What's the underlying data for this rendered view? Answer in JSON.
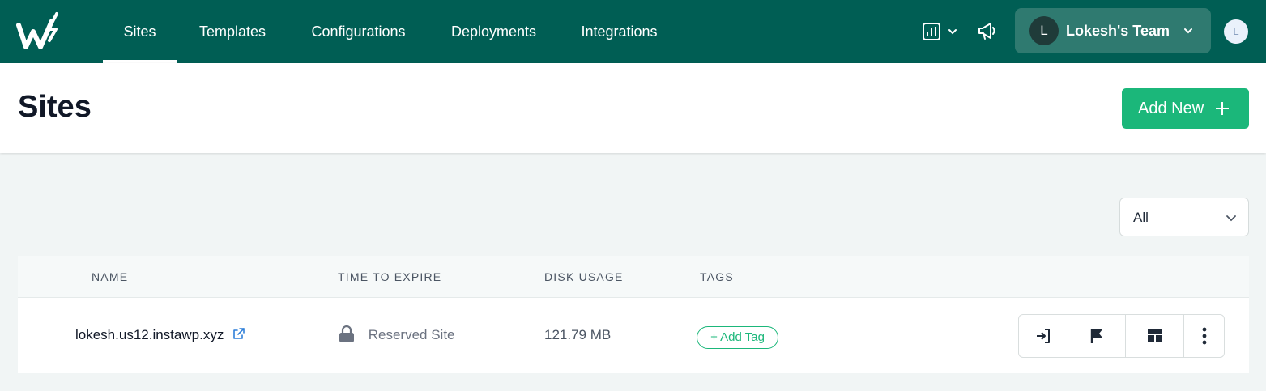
{
  "nav": {
    "items": [
      {
        "label": "Sites",
        "active": true
      },
      {
        "label": "Templates"
      },
      {
        "label": "Configurations"
      },
      {
        "label": "Deployments"
      },
      {
        "label": "Integrations"
      }
    ],
    "icons": [
      "logo-icon",
      "chart-icon",
      "chevron-down-icon",
      "megaphone-icon"
    ],
    "team": {
      "initial": "L",
      "name": "Lokesh's Team"
    },
    "user_initial": "L"
  },
  "header": {
    "title": "Sites",
    "add_new_label": "Add New"
  },
  "filter": {
    "selected": "All"
  },
  "table": {
    "columns": [
      "NAME",
      "TIME TO EXPIRE",
      "DISK USAGE",
      "TAGS"
    ],
    "rows": [
      {
        "name": "lokesh.us12.instawp.xyz",
        "time_to_expire": "Reserved Site",
        "disk_usage": "121.79 MB",
        "add_tag_label": "+ Add Tag"
      }
    ],
    "row_actions": [
      "login-icon",
      "flag-icon",
      "template-icon",
      "more-vertical-icon"
    ]
  },
  "colors": {
    "nav_bg": "#005e54",
    "accent_green": "#1bb77a",
    "team_bg": "#2f7a70",
    "page_bg": "#f1f5f5"
  }
}
